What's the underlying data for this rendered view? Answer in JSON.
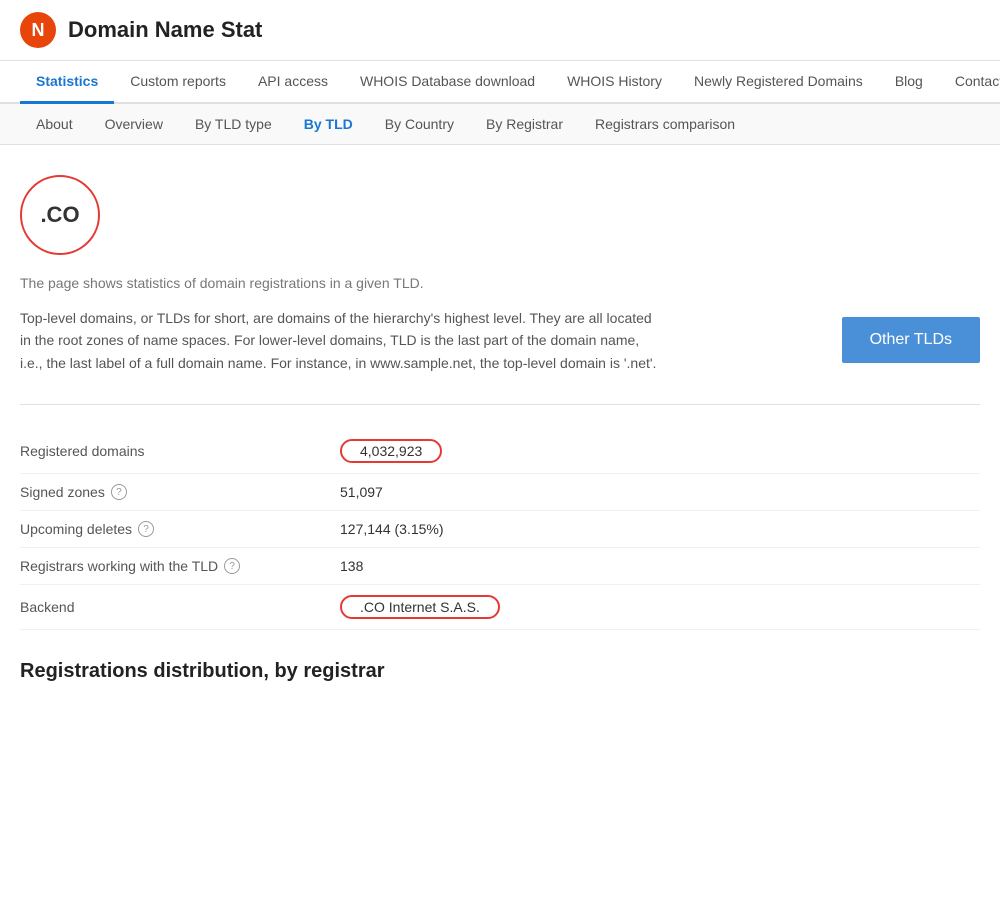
{
  "header": {
    "logo_letter": "N",
    "site_title": "Domain Name Stat"
  },
  "main_nav": {
    "items": [
      {
        "label": "Statistics",
        "active": true
      },
      {
        "label": "Custom reports",
        "active": false
      },
      {
        "label": "API access",
        "active": false
      },
      {
        "label": "WHOIS Database download",
        "active": false
      },
      {
        "label": "WHOIS History",
        "active": false
      },
      {
        "label": "Newly Registered Domains",
        "active": false
      },
      {
        "label": "Blog",
        "active": false
      },
      {
        "label": "Contact us",
        "active": false
      }
    ]
  },
  "sub_nav": {
    "items": [
      {
        "label": "About",
        "active": false
      },
      {
        "label": "Overview",
        "active": false
      },
      {
        "label": "By TLD type",
        "active": false
      },
      {
        "label": "By TLD",
        "active": true
      },
      {
        "label": "By Country",
        "active": false
      },
      {
        "label": "By Registrar",
        "active": false
      },
      {
        "label": "Registrars comparison",
        "active": false
      }
    ]
  },
  "tld": {
    "badge": ".CO",
    "description": "The page shows statistics of domain registrations in a given TLD.",
    "info_text": "Top-level domains, or TLDs for short, are domains of the hierarchy's highest level. They are all located in the root zones of name spaces. For lower-level domains, TLD is the last part of the domain name, i.e., the last label of a full domain name. For instance, in www.sample.net, the top-level domain is '.net'.",
    "other_tlds_label": "Other TLDs"
  },
  "stats": {
    "rows": [
      {
        "label": "Registered domains",
        "value": "4,032,923",
        "highlight_label": false,
        "highlight_value": true,
        "has_info": false
      },
      {
        "label": "Signed zones",
        "value": "51,097",
        "highlight_label": false,
        "highlight_value": false,
        "has_info": true
      },
      {
        "label": "Upcoming deletes",
        "value": "127,144 (3.15%)",
        "highlight_label": false,
        "highlight_value": false,
        "has_info": true
      },
      {
        "label": "Registrars working with the TLD",
        "value": "138",
        "highlight_label": false,
        "highlight_value": false,
        "has_info": true
      },
      {
        "label": "Backend",
        "value": ".CO Internet S.A.S.",
        "highlight_label": false,
        "highlight_value": true,
        "has_info": false
      }
    ]
  },
  "distribution": {
    "title": "Registrations distribution, by registrar"
  }
}
